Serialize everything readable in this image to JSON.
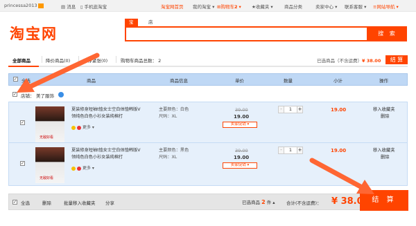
{
  "topbar": {
    "username": "princessa2013",
    "messages": "消息",
    "mobile": "手机逛淘宝",
    "home": "淘宝网首页",
    "my_taobao": "我的淘宝",
    "cart": "购物车",
    "cart_count": "2",
    "favorites": "收藏夹",
    "categories": "商品分类",
    "seller_center": "卖家中心",
    "contact": "联系客服",
    "sitemap": "网站导航"
  },
  "logo": "淘宝网",
  "search": {
    "tabs": [
      "宝贝",
      "店铺"
    ],
    "value": "",
    "button": "搜 索"
  },
  "tabs": [
    "全部商品",
    "降价商品(0)",
    "库存紧张(0)",
    "购物车商品总数： 2"
  ],
  "selected_summary": {
    "label": "已选商品（不含运费）",
    "amount": "¥ 38.00",
    "pay": "结 算"
  },
  "table_header": {
    "select_all": "全选",
    "product": "商品",
    "info": "商品信息",
    "unit_price": "单价",
    "quantity": "数量",
    "subtotal": "小计",
    "operation": "操作"
  },
  "shop": {
    "label": "店铺：",
    "name": "美了服饰"
  },
  "items": [
    {
      "title": "夏装修身短袖t恤女士空白体恤韩版V领纯色白色小衫女装纯棉打",
      "thumb_label": "无敌好看",
      "more": "更多",
      "color": "主要颜色：白色",
      "size": "尺码：XL",
      "old_price": "39.00",
      "price": "19.00",
      "promo": "卖家促销",
      "qty": "1",
      "subtotal": "19.00",
      "fav": "移入收藏夹",
      "del": "删除"
    },
    {
      "title": "夏装修身短袖t恤女士空白体恤韩版V领纯色白色小衫女装纯棉打",
      "thumb_label": "无敌好看",
      "more": "更多",
      "color": "主要颜色：黑色",
      "size": "尺码：XL",
      "old_price": "39.00",
      "price": "19.00",
      "promo": "卖家促销",
      "qty": "1",
      "subtotal": "19.00",
      "fav": "移入收藏夹",
      "del": "删除"
    }
  ],
  "footer": {
    "select_all": "全选",
    "delete": "删除",
    "batch_fav": "批量移入收藏夹",
    "share": "分享",
    "selected_label": "已选商品",
    "selected_count": "2",
    "selected_unit": "件",
    "total_label": "合计(不含运费)：",
    "total": "¥ 38.00",
    "pay": "结 算"
  },
  "colors": {
    "accent": "#ff4400",
    "header_blue": "#bfd8f5",
    "row_blue": "#e6f0fb"
  }
}
